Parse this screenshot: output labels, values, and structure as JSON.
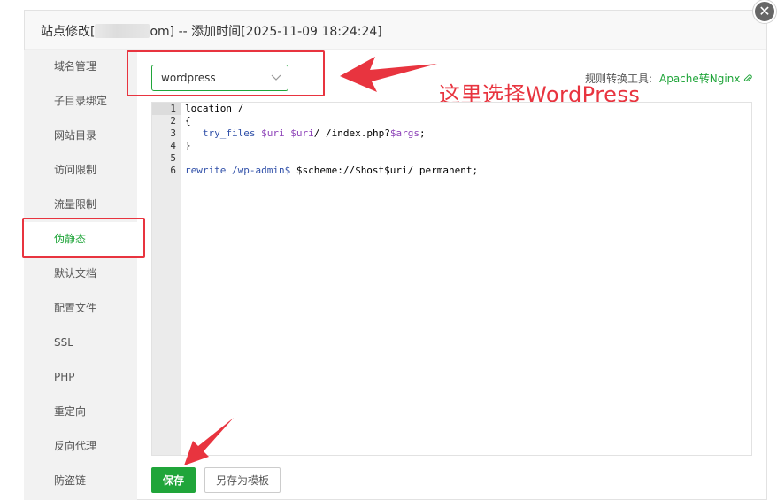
{
  "dialog": {
    "title_prefix": "站点修改[",
    "title_suffix": "om] -- 添加时间[2025-11-09 18:24:24]",
    "close_glyph": "✕"
  },
  "sidebar": {
    "items": [
      {
        "label": "域名管理"
      },
      {
        "label": "子目录绑定"
      },
      {
        "label": "网站目录"
      },
      {
        "label": "访问限制"
      },
      {
        "label": "流量限制"
      },
      {
        "label": "伪静态"
      },
      {
        "label": "默认文档"
      },
      {
        "label": "配置文件"
      },
      {
        "label": "SSL"
      },
      {
        "label": "PHP"
      },
      {
        "label": "重定向"
      },
      {
        "label": "反向代理"
      },
      {
        "label": "防盗链"
      }
    ],
    "active_index": 5
  },
  "rewrite": {
    "select_value": "wordpress",
    "tool_label": "规则转换工具:",
    "tool_link": "Apache转Nginx",
    "annotation": "这里选择WordPress"
  },
  "editor": {
    "line_numbers": [
      "1",
      "2",
      "3",
      "4",
      "5",
      "6"
    ]
  },
  "buttons": {
    "save": "保存",
    "save_as_template": "另存为模板"
  },
  "colors": {
    "accent": "#20a53a",
    "annotation": "#e8343f"
  },
  "icons": {
    "close": "close-icon",
    "chevron": "chevron-down-icon",
    "link": "paperclip-icon"
  }
}
